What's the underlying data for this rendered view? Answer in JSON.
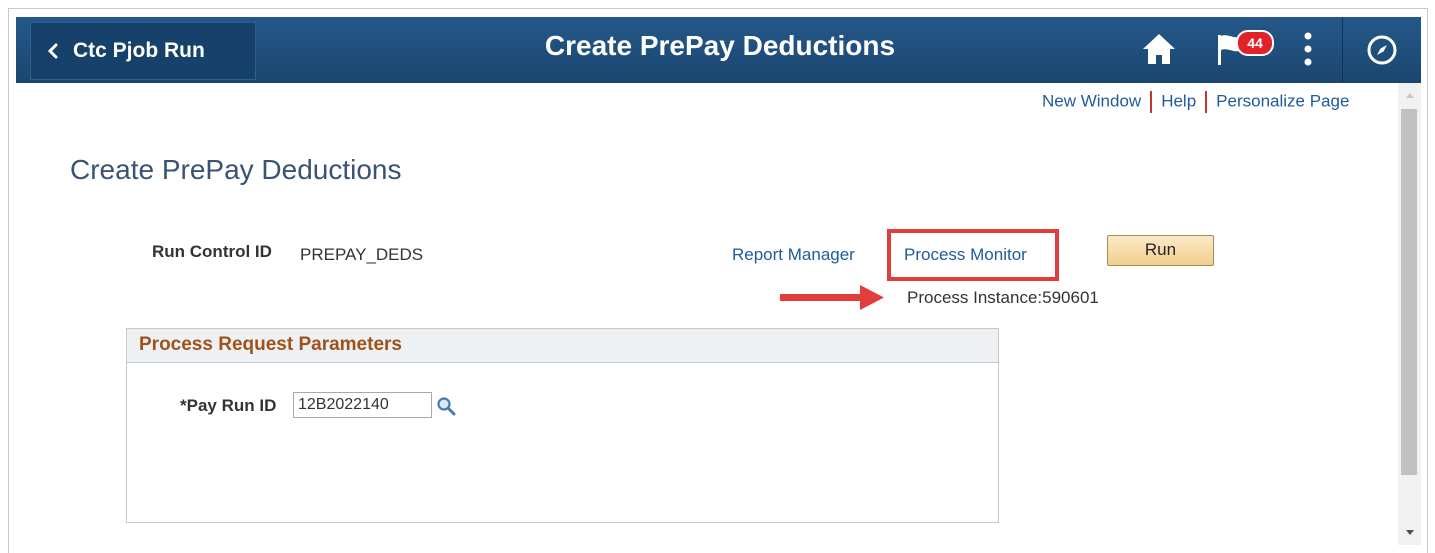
{
  "header": {
    "back_label": "Ctc Pjob Run",
    "title": "Create PrePay Deductions",
    "notification_count": "44",
    "icons": [
      "chevron-left-icon",
      "home-icon",
      "flag-icon",
      "more-vertical-icon",
      "compass-icon"
    ],
    "bar_color": "#1f4d7a"
  },
  "top_links": {
    "new_window": "New Window",
    "help": "Help",
    "personalize": "Personalize Page"
  },
  "page": {
    "heading": "Create PrePay Deductions",
    "run_control_label": "Run Control ID",
    "run_control_value": "PREPAY_DEDS",
    "report_manager": "Report Manager",
    "process_monitor": "Process Monitor",
    "run_button": "Run",
    "process_instance": "Process Instance:590601"
  },
  "panel": {
    "title": "Process Request Parameters",
    "pay_run_label": "*Pay Run ID",
    "pay_run_value": "12B2022140"
  },
  "colors": {
    "link": "#1f5b9a",
    "highlight": "#e23c3c",
    "panel_title": "#a0521a"
  }
}
